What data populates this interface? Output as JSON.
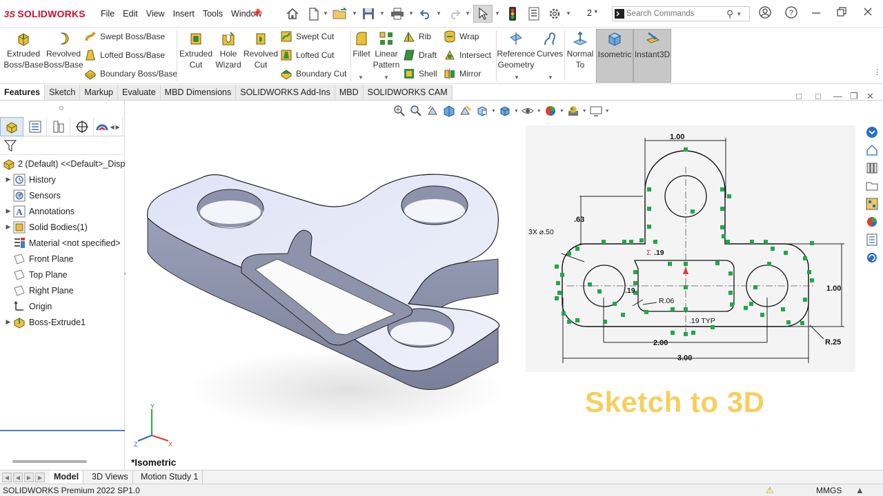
{
  "app": {
    "name": "SOLIDWORKS",
    "logo_prefix": "3S",
    "doc_name": "2 *"
  },
  "menu": [
    "File",
    "Edit",
    "View",
    "Insert",
    "Tools",
    "Window"
  ],
  "search": {
    "placeholder": "Search Commands"
  },
  "ribbon": {
    "extruded_boss": [
      "Extruded",
      "Boss/Base"
    ],
    "revolved_boss": [
      "Revolved",
      "Boss/Base"
    ],
    "swept_boss": "Swept Boss/Base",
    "lofted_boss": "Lofted Boss/Base",
    "boundary_boss": "Boundary Boss/Base",
    "extruded_cut": [
      "Extruded",
      "Cut"
    ],
    "hole_wizard": [
      "Hole",
      "Wizard"
    ],
    "revolved_cut": [
      "Revolved",
      "Cut"
    ],
    "swept_cut": "Swept Cut",
    "lofted_cut": "Lofted Cut",
    "boundary_cut": "Boundary Cut",
    "fillet": "Fillet",
    "linear_pattern": [
      "Linear",
      "Pattern"
    ],
    "rib": "Rib",
    "draft": "Draft",
    "shell": "Shell",
    "wrap": "Wrap",
    "intersect": "Intersect",
    "mirror": "Mirror",
    "reference_geometry": [
      "Reference",
      "Geometry"
    ],
    "curves": "Curves",
    "normal_to": [
      "Normal",
      "To"
    ],
    "isometric": "Isometric",
    "instant3d": "Instant3D"
  },
  "tabs": [
    "Features",
    "Sketch",
    "Markup",
    "Evaluate",
    "MBD Dimensions",
    "SOLIDWORKS Add-Ins",
    "MBD",
    "SOLIDWORKS CAM"
  ],
  "tree": {
    "root": "2 (Default) <<Default>_Displ",
    "items": [
      "History",
      "Sensors",
      "Annotations",
      "Solid Bodies(1)",
      "Material <not specified>",
      "Front Plane",
      "Top Plane",
      "Right Plane",
      "Origin",
      "Boss-Extrude1"
    ]
  },
  "drawing": {
    "dims": {
      "top_width": "1.00",
      "holes": "3X ⌀.50",
      "height_063": ".63",
      "slot_019": ".19",
      "slot_019b": ".19",
      "r006": "R.06",
      "typ": ".19 TYP",
      "right_h": "1.00",
      "center_w": "2.00",
      "overall_w": "3.00",
      "r025": "R.25"
    }
  },
  "viewport": {
    "view_label": "*Isometric",
    "overlay_text": "Sketch to 3D",
    "axes": {
      "x": "X",
      "y": "Y",
      "z": "Z"
    }
  },
  "bottom_tabs": [
    "Model",
    "3D Views",
    "Motion Study 1"
  ],
  "status": {
    "product": "SOLIDWORKS Premium 2022 SP1.0",
    "units": "MMGS"
  },
  "colors": {
    "brand": "#c8102e",
    "overlay_text": "#f5cf5e",
    "part_face": "#e1e5f7",
    "part_side": "#8d93aa",
    "sketch_relation": "#1fa84a"
  }
}
